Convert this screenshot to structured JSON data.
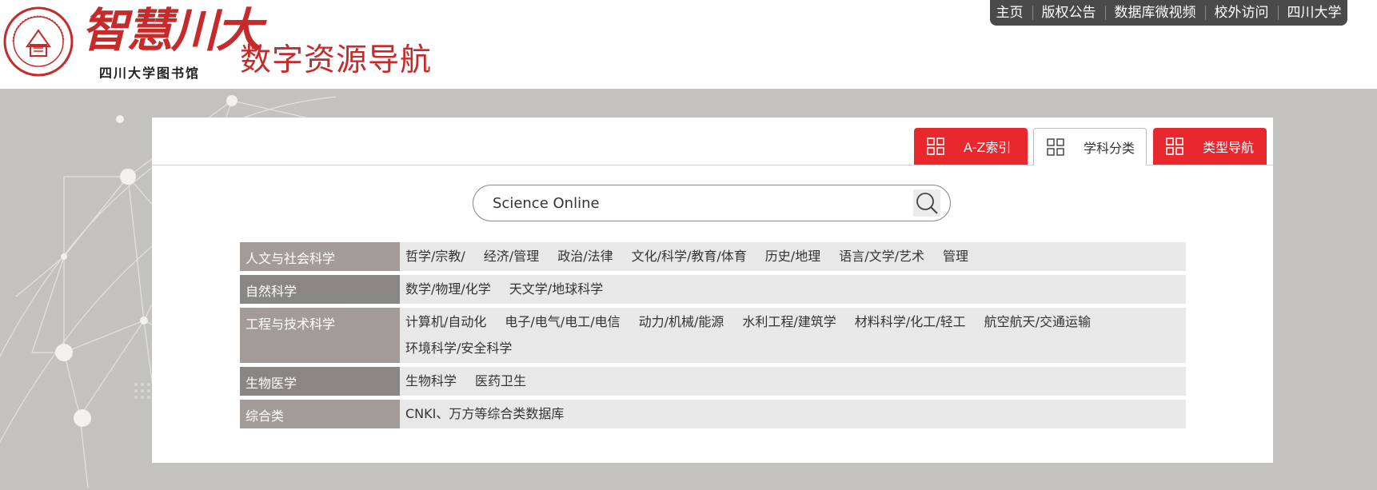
{
  "header": {
    "logo_seal_text": "SICHUAN UNIVERSITY LIBRARY 1704",
    "logo_calligraphy": "智慧川大",
    "logo_subtitle": "四川大学图书馆",
    "site_title": "数字资源导航"
  },
  "topnav": {
    "items": [
      "主页",
      "版权公告",
      "数据库微视频",
      "校外访问",
      "四川大学"
    ]
  },
  "tabs": [
    {
      "label": "A-Z索引",
      "icon": "grid-icon",
      "active": false
    },
    {
      "label": "学科分类",
      "icon": "grid-icon",
      "active": true
    },
    {
      "label": "类型导航",
      "icon": "grid-icon",
      "active": false
    }
  ],
  "search": {
    "value": "Science Online",
    "icon": "search-icon"
  },
  "categories": [
    {
      "name": "人文与社会科学",
      "items": [
        "哲学/宗教/",
        "经济/管理",
        "政治/法律",
        "文化/科学/教育/体育",
        "历史/地理",
        "语言/文学/艺术",
        "管理"
      ]
    },
    {
      "name": "自然科学",
      "items": [
        "数学/物理/化学",
        "天文学/地球科学"
      ]
    },
    {
      "name": "工程与技术科学",
      "items": [
        "计算机/自动化",
        "电子/电气/电工/电信",
        "动力/机械/能源",
        "水利工程/建筑学",
        "材料科学/化工/轻工",
        "航空航天/交通运输",
        "环境科学/安全科学"
      ]
    },
    {
      "name": "生物医学",
      "items": [
        "生物科学",
        "医药卫生"
      ]
    },
    {
      "name": "综合类",
      "items": [
        "CNKI、万方等综合类数据库"
      ]
    }
  ],
  "colors": {
    "brand_red": "#c62a2a",
    "tab_red": "#e8282d",
    "topnav_bg": "#4a4a4a",
    "page_bg": "#c4c2c0"
  }
}
